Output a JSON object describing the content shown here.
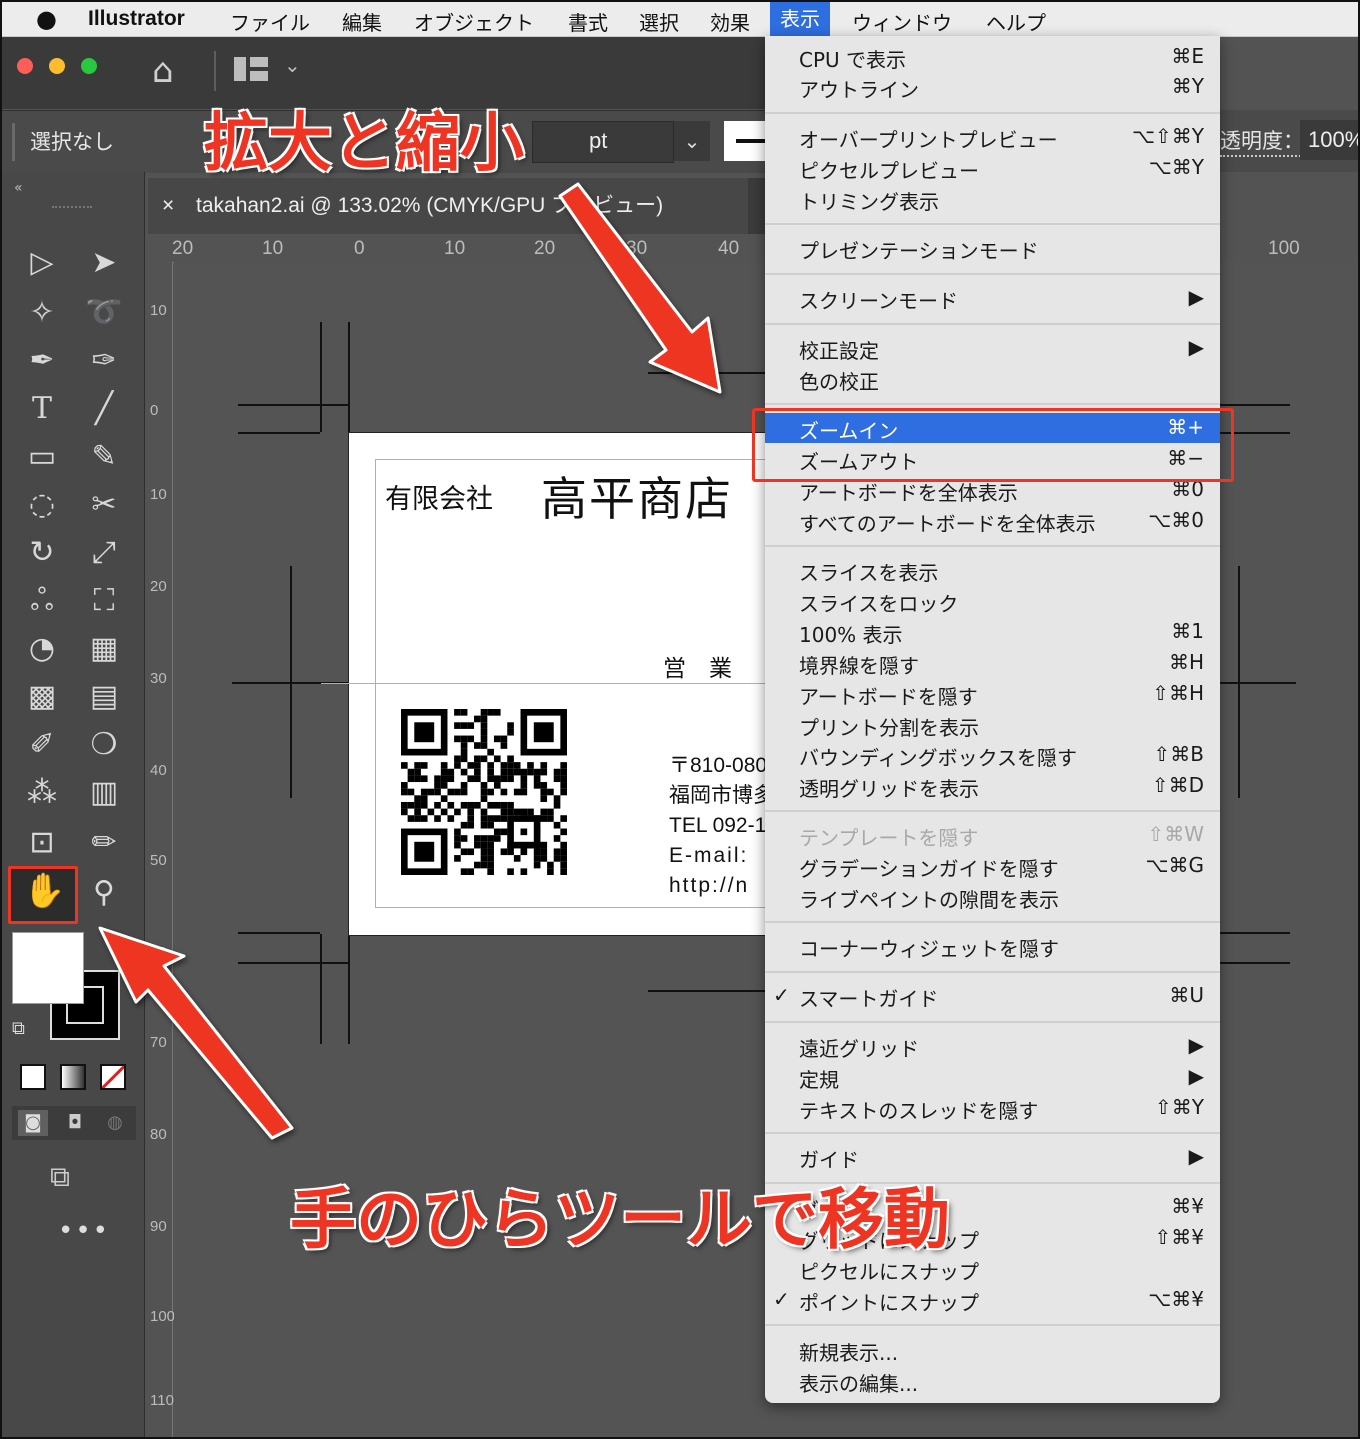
{
  "menubar": {
    "app": "Illustrator",
    "items": [
      "ファイル",
      "編集",
      "オブジェクト",
      "書式",
      "選択",
      "効果",
      "表示",
      "ウィンドウ",
      "ヘルプ"
    ],
    "active": "表示"
  },
  "control_bar": {
    "selection": "選択なし",
    "unit": "pt",
    "opacity_label": "透明度：",
    "opacity_value": "100%"
  },
  "document_tab": {
    "close": "×",
    "title": "takahan2.ai @ 133.02% (CMYK/GPU プレビュー)"
  },
  "hruler": [
    "20",
    "10",
    "0",
    "10",
    "20",
    "30",
    "40",
    "100"
  ],
  "vruler": [
    "10",
    "0",
    "10",
    "20",
    "30",
    "40",
    "50",
    "60",
    "70",
    "80",
    "90",
    "100",
    "110"
  ],
  "card": {
    "company_prefix": "有限会社",
    "company_name": "高平商店",
    "dept": "営　業",
    "postal": "〒810-080",
    "address": "福岡市博多",
    "tel": "TEL 092-1",
    "email": "E-mail:",
    "url": "http://n"
  },
  "view_menu": [
    {
      "label": "CPU で表示",
      "shortcut": "⌘E"
    },
    {
      "label": "アウトライン",
      "shortcut": "⌘Y"
    },
    {
      "label": "オーバープリントプレビュー",
      "shortcut": "⌥⇧⌘Y"
    },
    {
      "label": "ピクセルプレビュー",
      "shortcut": "⌥⌘Y"
    },
    {
      "label": "トリミング表示",
      "shortcut": ""
    },
    {
      "label": "プレゼンテーションモード",
      "shortcut": ""
    },
    {
      "label": "スクリーンモード",
      "shortcut": "▶"
    },
    {
      "label": "校正設定",
      "shortcut": "▶"
    },
    {
      "label": "色の校正",
      "shortcut": ""
    },
    {
      "label": "ズームイン",
      "shortcut": "⌘+"
    },
    {
      "label": "ズームアウト",
      "shortcut": "⌘−"
    },
    {
      "label": "アートボードを全体表示",
      "shortcut": "⌘0"
    },
    {
      "label": "すべてのアートボードを全体表示",
      "shortcut": "⌥⌘0"
    },
    {
      "label": "スライスを表示",
      "shortcut": ""
    },
    {
      "label": "スライスをロック",
      "shortcut": ""
    },
    {
      "label": "100% 表示",
      "shortcut": "⌘1"
    },
    {
      "label": "境界線を隠す",
      "shortcut": "⌘H"
    },
    {
      "label": "アートボードを隠す",
      "shortcut": "⇧⌘H"
    },
    {
      "label": "プリント分割を表示",
      "shortcut": ""
    },
    {
      "label": "バウンディングボックスを隠す",
      "shortcut": "⇧⌘B"
    },
    {
      "label": "透明グリッドを表示",
      "shortcut": "⇧⌘D"
    },
    {
      "label": "テンプレートを隠す",
      "shortcut": "⇧⌘W"
    },
    {
      "label": "グラデーションガイドを隠す",
      "shortcut": "⌥⌘G"
    },
    {
      "label": "ライブペイントの隙間を表示",
      "shortcut": ""
    },
    {
      "label": "コーナーウィジェットを隠す",
      "shortcut": ""
    },
    {
      "label": "スマートガイド",
      "shortcut": "⌘U",
      "check": "✓"
    },
    {
      "label": "遠近グリッド",
      "shortcut": "▶"
    },
    {
      "label": "定規",
      "shortcut": "▶"
    },
    {
      "label": "テキストのスレッドを隠す",
      "shortcut": "⇧⌘Y"
    },
    {
      "label": "ガイド",
      "shortcut": "▶"
    },
    {
      "label": "グ",
      "shortcut": "⌘¥"
    },
    {
      "label": "グリッドにスナップ",
      "shortcut": "⇧⌘¥"
    },
    {
      "label": "ピクセルにスナップ",
      "shortcut": ""
    },
    {
      "label": "ポイントにスナップ",
      "shortcut": "⌥⌘¥",
      "check": "✓"
    },
    {
      "label": "新規表示...",
      "shortcut": ""
    },
    {
      "label": "表示の編集...",
      "shortcut": ""
    }
  ],
  "annotations": {
    "zoom": "拡大と縮小",
    "hand": "手のひらツールで移動"
  },
  "colors": {
    "accent_red": "#ee3524",
    "highlight_blue": "#2f6ee0",
    "guide_cyan": "#58d6d4"
  }
}
